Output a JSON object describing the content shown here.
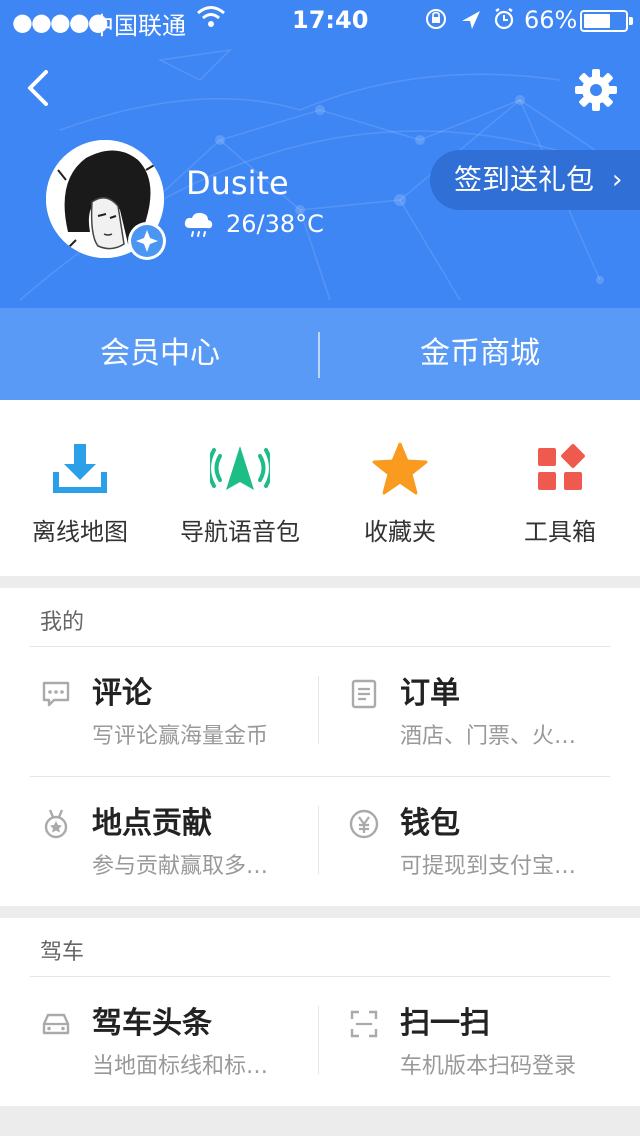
{
  "status_bar": {
    "signal": "●●●●●",
    "carrier": "中国联通",
    "time": "17:40",
    "battery_pct": "66%",
    "battery_level": 0.66
  },
  "profile": {
    "username": "Dusite",
    "weather": "26/38°C",
    "signin_label": "签到送礼包"
  },
  "member_bar": {
    "left": "会员中心",
    "right": "金币商城"
  },
  "tools": [
    {
      "label": "离线地图",
      "icon": "download-icon",
      "color": "#2b9fe8"
    },
    {
      "label": "导航语音包",
      "icon": "nav-voice-icon",
      "color": "#1dbd85"
    },
    {
      "label": "收藏夹",
      "icon": "star-icon",
      "color": "#f89b1f"
    },
    {
      "label": "工具箱",
      "icon": "toolbox-icon",
      "color": "#ef5a4f"
    }
  ],
  "mine": {
    "title": "我的",
    "items": [
      {
        "title": "评论",
        "sub": "写评论赢海量金币",
        "icon": "comment-icon"
      },
      {
        "title": "订单",
        "sub": "酒店、门票、火…",
        "icon": "order-icon"
      },
      {
        "title": "地点贡献",
        "sub": "参与贡献赢取多…",
        "icon": "medal-icon"
      },
      {
        "title": "钱包",
        "sub": "可提现到支付宝…",
        "icon": "wallet-icon"
      }
    ]
  },
  "drive": {
    "title": "驾车",
    "items": [
      {
        "title": "驾车头条",
        "sub": "当地面标线和标…",
        "icon": "car-icon"
      },
      {
        "title": "扫一扫",
        "sub": "车机版本扫码登录",
        "icon": "scan-icon"
      }
    ]
  },
  "colors": {
    "header_blue": "#3f86f5",
    "member_bar_blue": "#5a9af7"
  }
}
